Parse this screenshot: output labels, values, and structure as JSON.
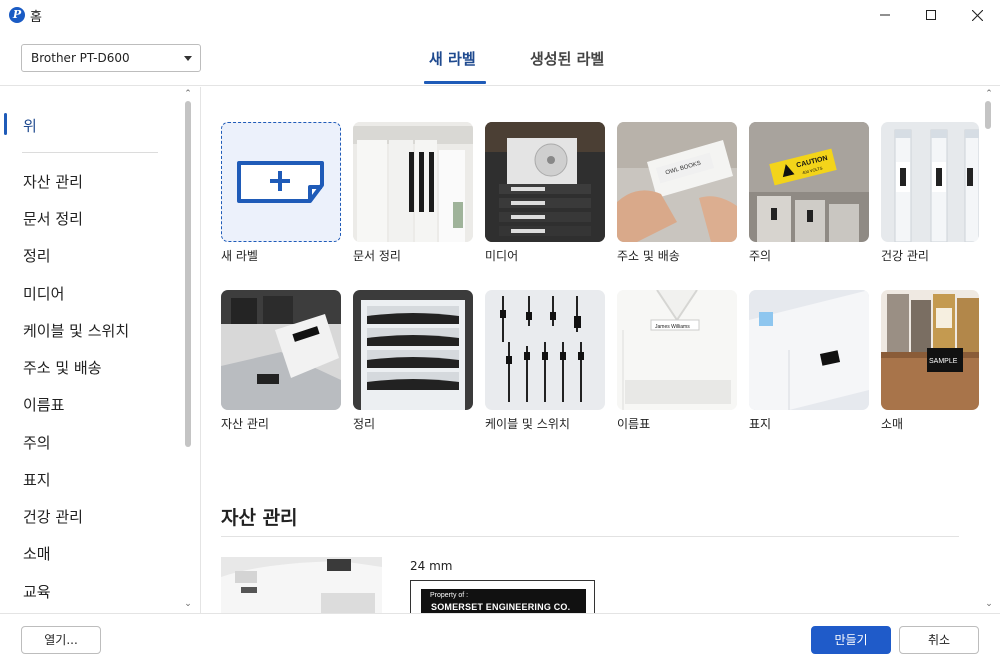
{
  "window": {
    "title": "홈",
    "app_icon_letter": "P"
  },
  "header": {
    "printer": "Brother PT-D600",
    "tabs": [
      {
        "label": "새 라벨"
      },
      {
        "label": "생성된 라벨"
      }
    ]
  },
  "sidebar": {
    "items": [
      {
        "label": "위"
      },
      {
        "label": "자산 관리"
      },
      {
        "label": "문서 정리"
      },
      {
        "label": "정리"
      },
      {
        "label": "미디어"
      },
      {
        "label": "케이블 및 스위치"
      },
      {
        "label": "주소 및 배송"
      },
      {
        "label": "이름표"
      },
      {
        "label": "주의"
      },
      {
        "label": "표지"
      },
      {
        "label": "건강 관리"
      },
      {
        "label": "소매"
      },
      {
        "label": "교육"
      }
    ]
  },
  "tiles": [
    {
      "label": "새 라벨",
      "icon": "new-label-icon"
    },
    {
      "label": "문서 정리"
    },
    {
      "label": "미디어"
    },
    {
      "label": "주소 및 배송",
      "image_text": "OWL BOOKS"
    },
    {
      "label": "주의",
      "image_text": "CAUTION",
      "image_subtext": "400 VOLTS"
    },
    {
      "label": "건강 관리"
    },
    {
      "label": "자산 관리"
    },
    {
      "label": "정리"
    },
    {
      "label": "케이블 및 스위치"
    },
    {
      "label": "이름표",
      "image_text": "James Williams"
    },
    {
      "label": "표지"
    },
    {
      "label": "소매",
      "image_text": "SAMPLE"
    }
  ],
  "section": {
    "title": "자산 관리",
    "size": "24 mm",
    "label_small": "Property of :",
    "label_big": "SOMERSET ENGINEERING CO."
  },
  "footer": {
    "open": "열기...",
    "make": "만들기",
    "cancel": "취소"
  },
  "colors": {
    "accent": "#1f5bc9",
    "active_text": "#1f4a8f"
  }
}
